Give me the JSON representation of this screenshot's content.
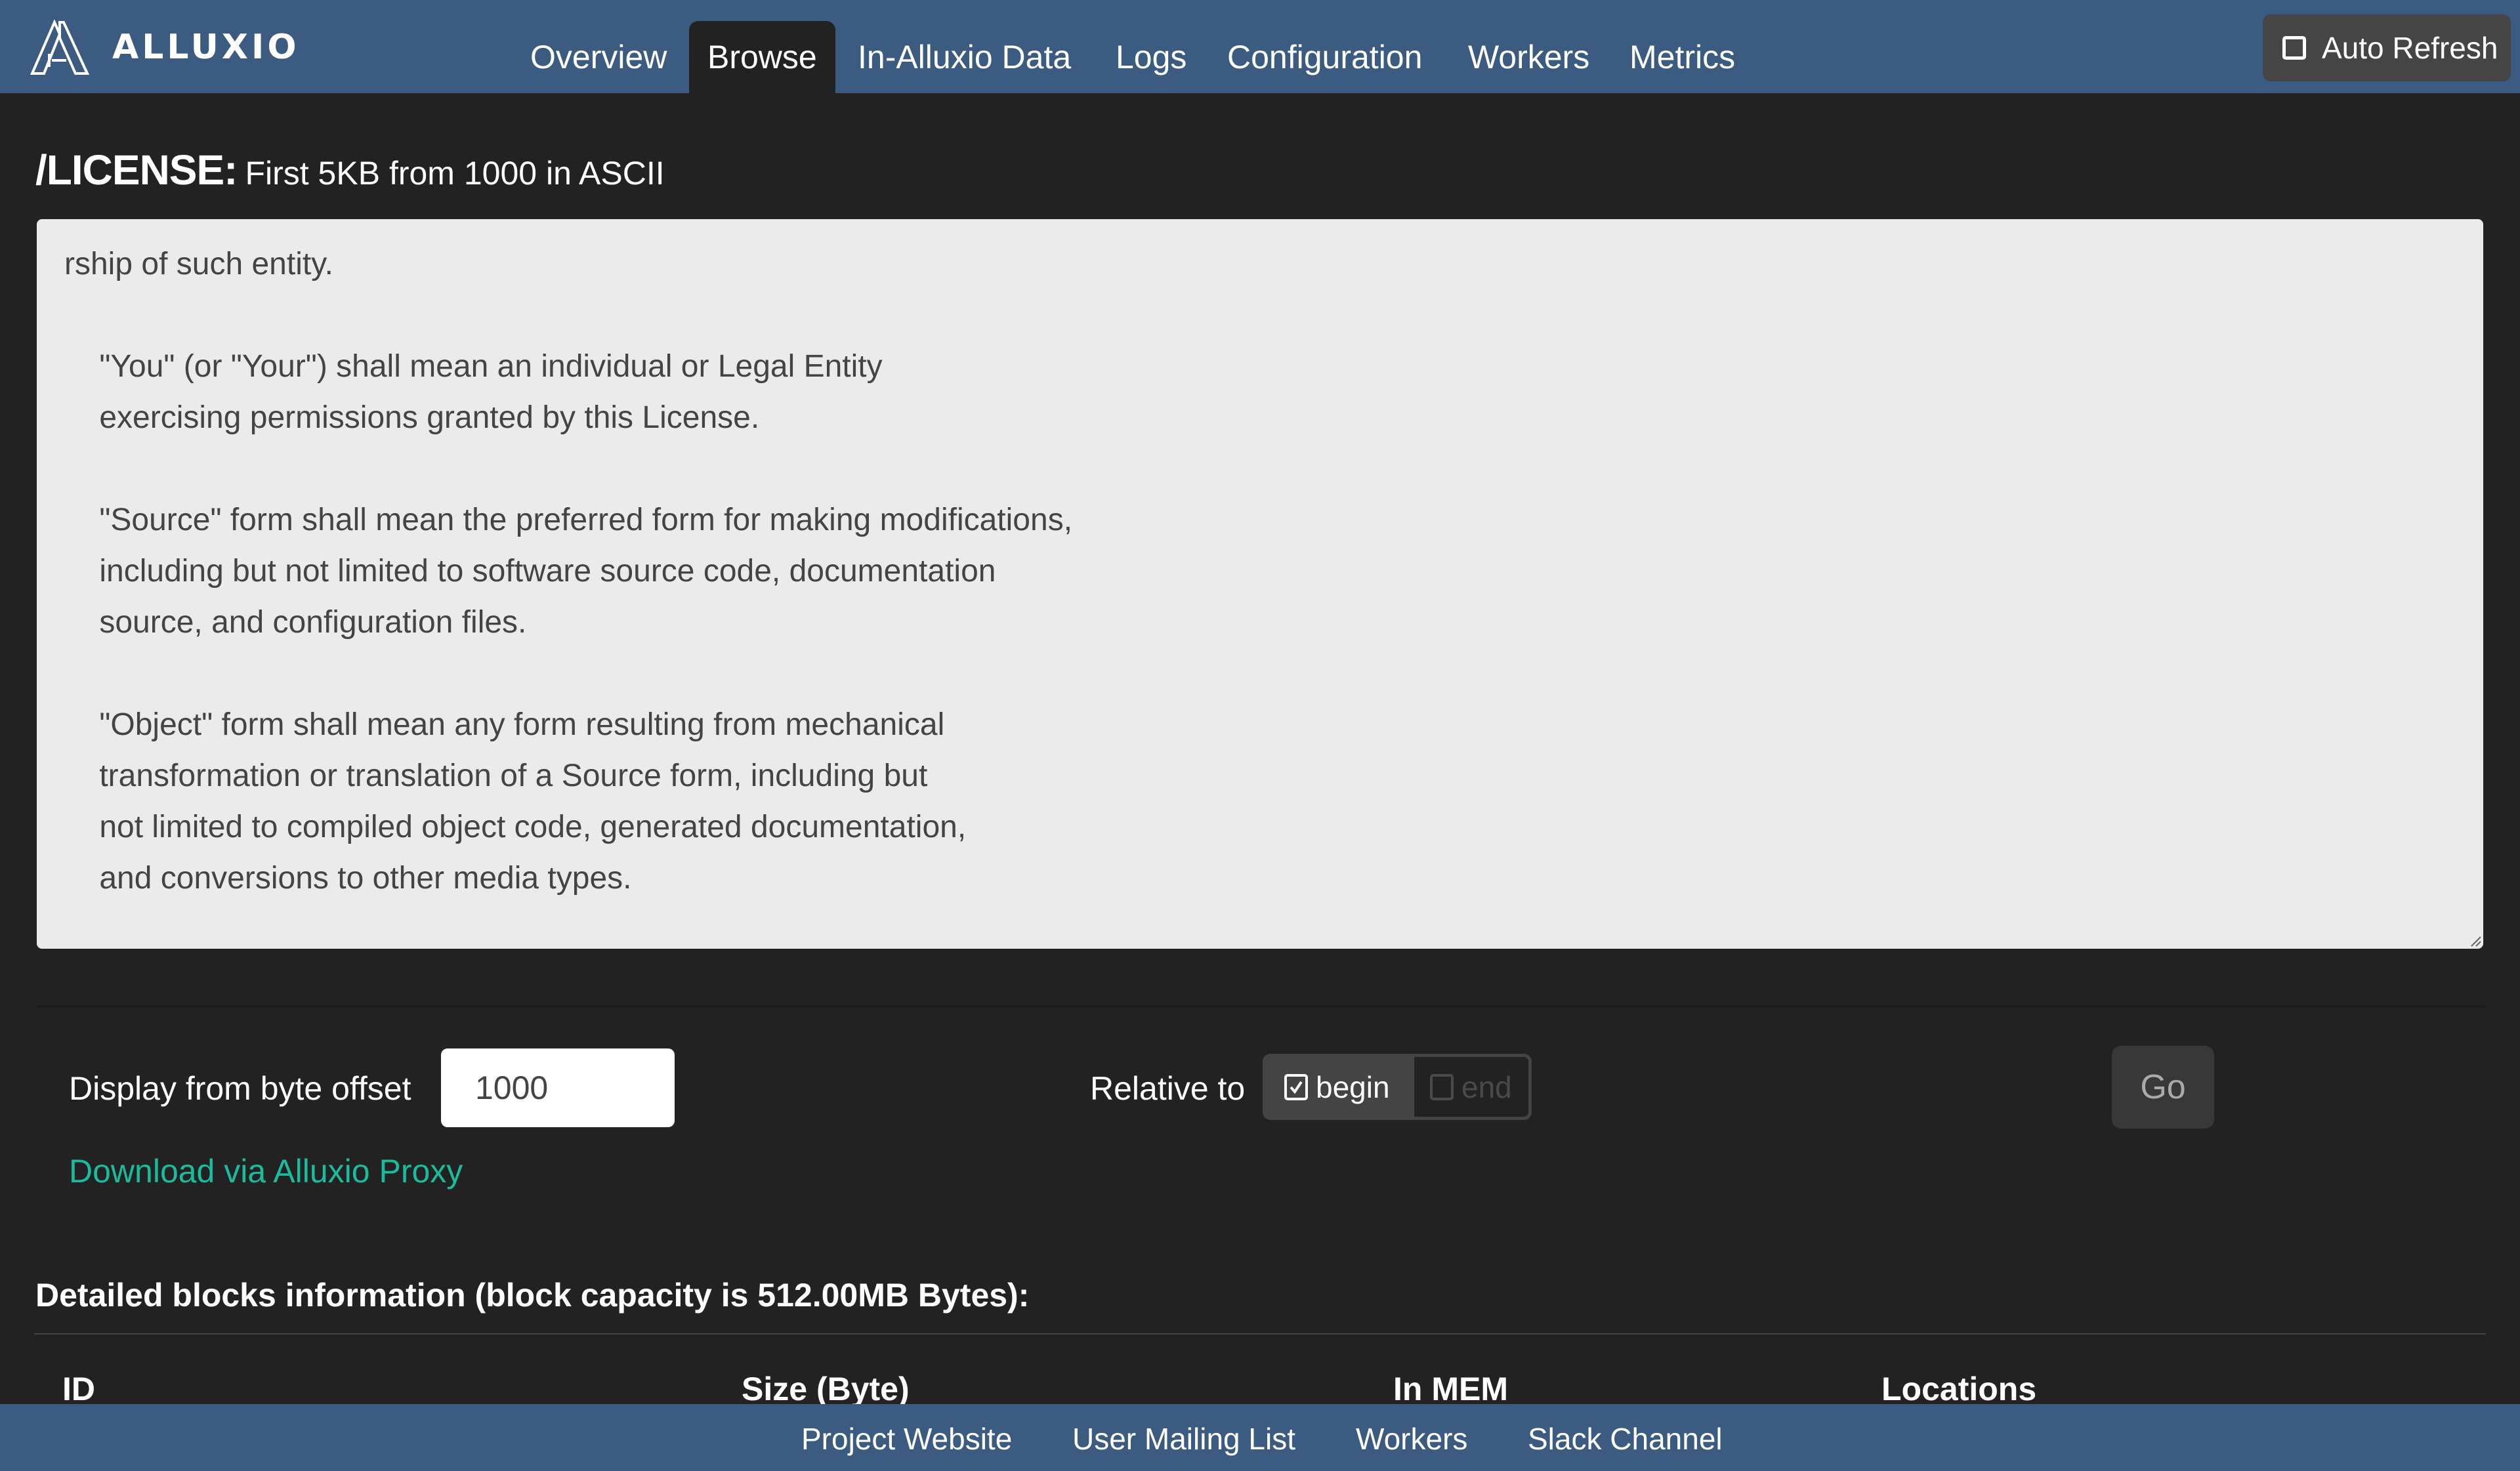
{
  "navbar": {
    "brand": "ALLUXIO",
    "items": [
      {
        "label": "Overview",
        "active": false
      },
      {
        "label": "Browse",
        "active": true
      },
      {
        "label": "In-Alluxio Data",
        "active": false
      },
      {
        "label": "Logs",
        "active": false
      },
      {
        "label": "Configuration",
        "active": false
      },
      {
        "label": "Workers",
        "active": false
      },
      {
        "label": "Metrics",
        "active": false
      }
    ],
    "auto_refresh": {
      "label": "Auto Refresh",
      "checked": false
    }
  },
  "file_view": {
    "path": "/LICENSE:",
    "subtitle": "First 5KB from 1000 in ASCII",
    "content": "rship of such entity.\n\n    \"You\" (or \"Your\") shall mean an individual or Legal Entity\n    exercising permissions granted by this License.\n\n    \"Source\" form shall mean the preferred form for making modifications,\n    including but not limited to software source code, documentation\n    source, and configuration files.\n\n    \"Object\" form shall mean any form resulting from mechanical\n    transformation or translation of a Source form, including but\n    not limited to compiled object code, generated documentation,\n    and conversions to other media types."
  },
  "controls": {
    "offset_label": "Display from byte offset",
    "offset_value": "1000",
    "relative_label": "Relative to",
    "relative_options": [
      {
        "label": "begin",
        "checked": true
      },
      {
        "label": "end",
        "checked": false
      }
    ],
    "go_label": "Go",
    "download_label": "Download via Alluxio Proxy"
  },
  "blocks": {
    "heading": "Detailed blocks information (block capacity is 512.00MB Bytes):",
    "columns": [
      "ID",
      "Size (Byte)",
      "In MEM",
      "Locations"
    ]
  },
  "footer": {
    "links": [
      "Project Website",
      "User Mailing List",
      "Workers",
      "Slack Channel"
    ]
  },
  "colors": {
    "navbar_bg": "#3b5b80",
    "page_bg": "#222222",
    "panel_bg": "#ebebeb",
    "link_green": "#1abc9c"
  }
}
